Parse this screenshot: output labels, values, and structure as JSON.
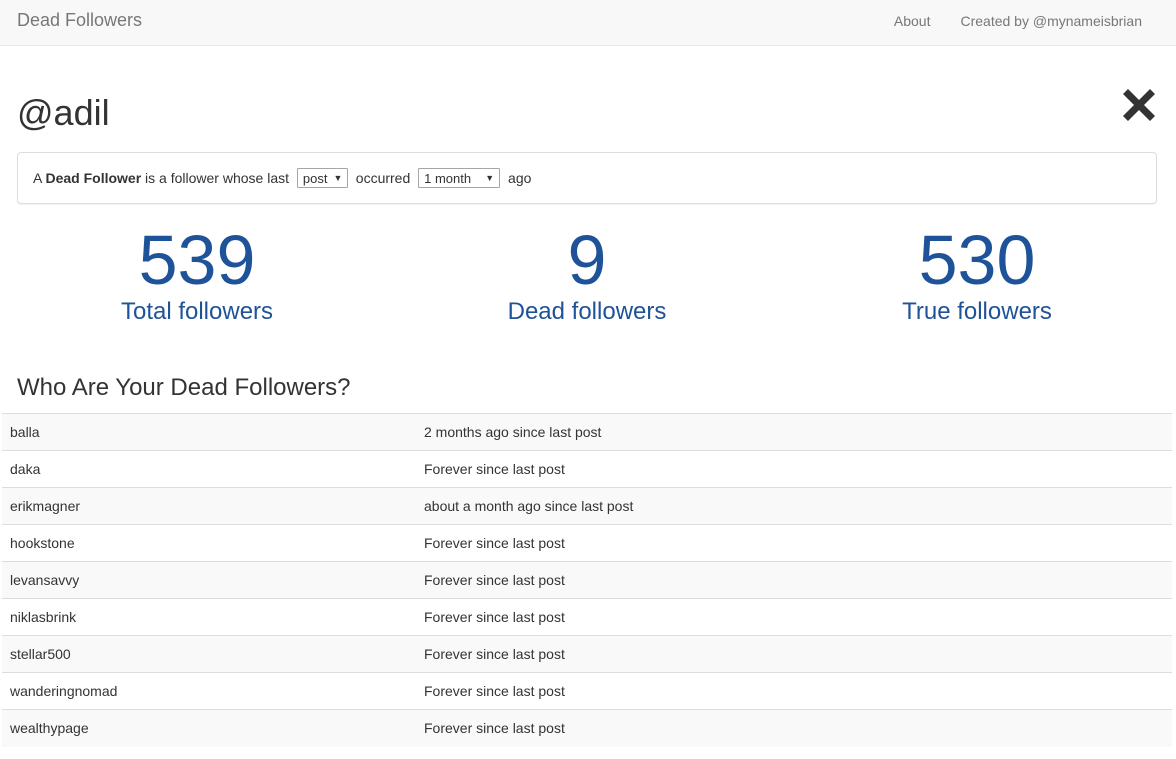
{
  "navbar": {
    "brand": "Dead Followers",
    "links": [
      {
        "label": "About"
      },
      {
        "label": "Created by @mynameisbrian"
      }
    ]
  },
  "profile": {
    "handle": "@adil",
    "close_icon": "close-x-icon"
  },
  "definition": {
    "prefix": "A ",
    "term": "Dead Follower",
    "middle": " is a follower whose last ",
    "activity_type": "post",
    "occurred": " occurred ",
    "period": "1 month",
    "suffix": " ago"
  },
  "stats": [
    {
      "value": "539",
      "label": "Total followers"
    },
    {
      "value": "9",
      "label": "Dead followers"
    },
    {
      "value": "530",
      "label": "True followers"
    }
  ],
  "accent_color": "#1e5299",
  "dead_list": {
    "title": "Who Are Your Dead Followers?",
    "rows": [
      {
        "name": "balla",
        "status": "2 months ago since last post"
      },
      {
        "name": "daka",
        "status": "Forever since last post"
      },
      {
        "name": "erikmagner",
        "status": "about a month ago since last post"
      },
      {
        "name": "hookstone",
        "status": "Forever since last post"
      },
      {
        "name": "levansavvy",
        "status": "Forever since last post"
      },
      {
        "name": "niklasbrink",
        "status": "Forever since last post"
      },
      {
        "name": "stellar500",
        "status": "Forever since last post"
      },
      {
        "name": "wanderingnomad",
        "status": "Forever since last post"
      },
      {
        "name": "wealthypage",
        "status": "Forever since last post"
      }
    ]
  }
}
